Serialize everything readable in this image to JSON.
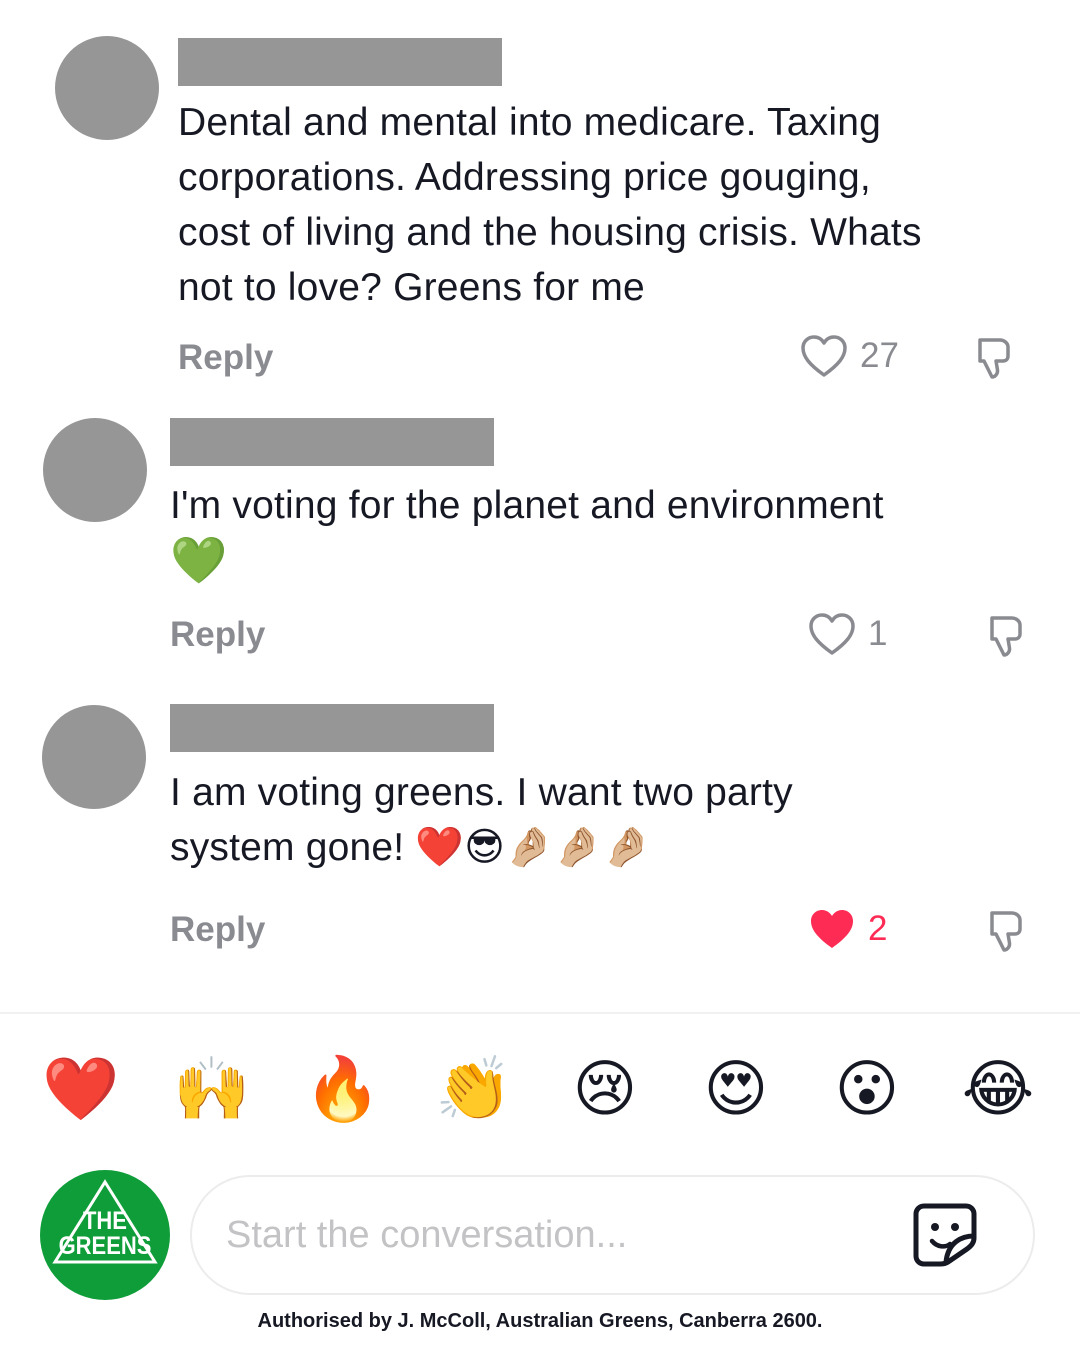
{
  "comments": [
    {
      "text_lines": [
        "Dental and mental into medicare. Taxing",
        "corporations. Addressing price gouging,",
        "cost of living and the housing crisis. Whats",
        "not to love? Greens for me"
      ],
      "reply_label": "Reply",
      "likes": "27",
      "liked": false
    },
    {
      "text_lines": [
        "I'm voting for the planet and environment",
        "💚"
      ],
      "reply_label": "Reply",
      "likes": "1",
      "liked": false
    },
    {
      "text_lines": [
        "I am voting greens. I want two party",
        "system gone! ❤️😎🤌🏼🤌🏼🤌🏼"
      ],
      "reply_label": "Reply",
      "likes": "2",
      "liked": true
    }
  ],
  "quick_reactions": [
    "❤️",
    "🙌",
    "🔥",
    "👏",
    "😢",
    "😍",
    "😮",
    "😂"
  ],
  "logo": {
    "line1": "THE",
    "line2": "GREENS",
    "color": "#0f9d3a"
  },
  "input": {
    "placeholder": "Start the conversation..."
  },
  "footer": "Authorised by J. McColl, Australian Greens, Canberra 2600.",
  "colors": {
    "liked": "#fe2c55",
    "muted": "#8a8b91",
    "redacted": "#969696"
  }
}
